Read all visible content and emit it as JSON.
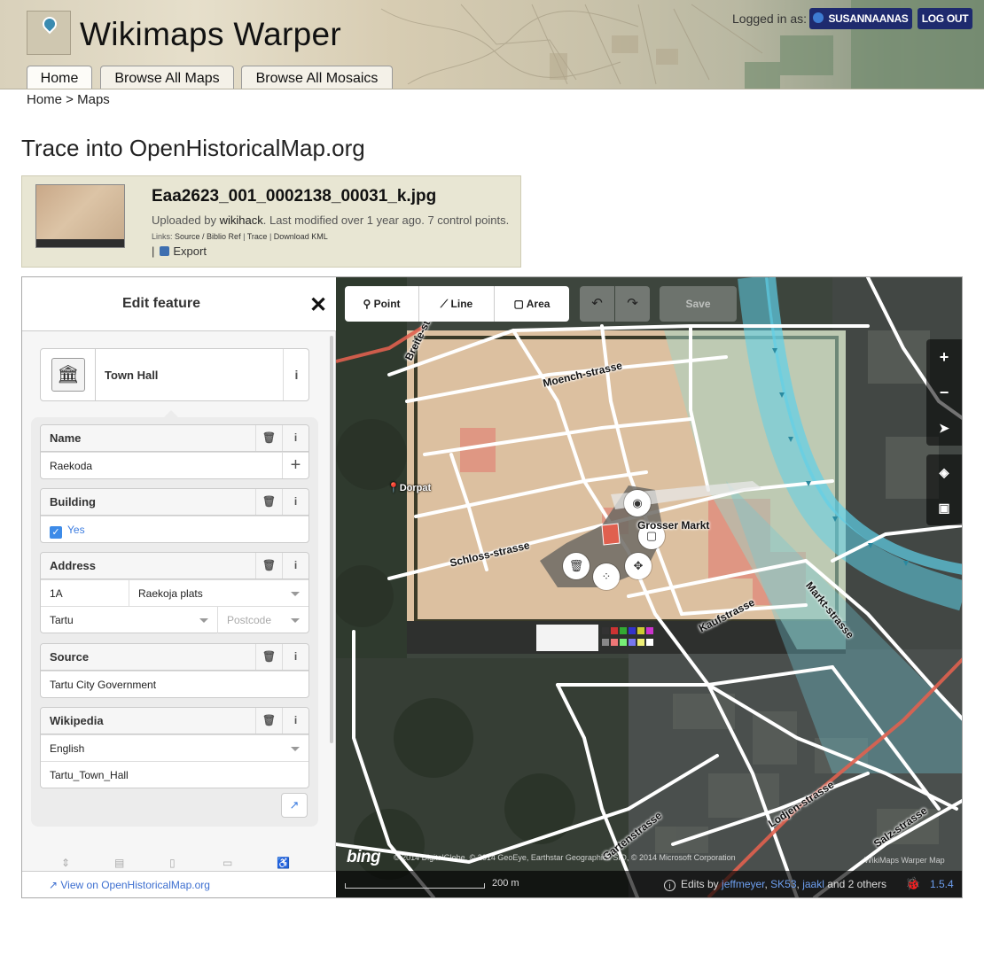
{
  "site": {
    "title": "Wikimaps Warper",
    "logged_in_label": "Logged in as:",
    "username": "SUSANNAANAS",
    "logout": "LOG OUT",
    "tabs": [
      "Home",
      "Browse All Maps",
      "Browse All Mosaics"
    ]
  },
  "breadcrumb": "Home > Maps",
  "page_title": "Trace into OpenHistoricalMap.org",
  "map_info": {
    "file_name": "Eaa2623_001_0002138_00031_k.jpg",
    "uploaded_prefix": "Uploaded by",
    "uploader": "wikihack",
    "uploaded_suffix": ". Last modified over 1 year ago. 7 control points.",
    "links_label": "Links:",
    "link_source": "Source / Biblio Ref",
    "link_trace": "Trace",
    "link_kml": "Download KML",
    "export": "Export"
  },
  "editor": {
    "sidebar_title": "Edit feature",
    "close_glyph": "✕",
    "preset_name": "Town Hall",
    "info_glyph": "i",
    "fields": {
      "name": {
        "label": "Name",
        "value": "Raekoda"
      },
      "building": {
        "label": "Building",
        "value": "Yes"
      },
      "address": {
        "label": "Address",
        "housenumber": "1A",
        "street": "Raekoja plats",
        "city": "Tartu",
        "postcode_placeholder": "Postcode"
      },
      "source": {
        "label": "Source",
        "value": "Tartu City Government"
      },
      "wikipedia": {
        "label": "Wikipedia",
        "language": "English",
        "article": "Tartu_Town_Hall"
      }
    },
    "view_on_osm": "View on OpenHistoricalMap.org"
  },
  "map": {
    "modes": {
      "point": "Point",
      "line": "Line",
      "area": "Area"
    },
    "save": "Save",
    "labels": {
      "dorpat": "Dorpat",
      "moench": "Moench-strasse",
      "schloss": "Schloss-strasse",
      "markt": "Markt-strasse",
      "kauf": "Kaufstrasse",
      "lodjen": "Lodjen-strasse",
      "garten": "Gartenstrasse",
      "salz": "Salz-strasse",
      "breite": "Breite-str",
      "gross_markt": "Grosser Markt"
    },
    "bing": "bing",
    "attribution": "© 2014 DigitalGlobe, © 2014 GeoEye, Earthstar Geographics SIO, © 2014 Microsoft Corporation",
    "watermark": "WikiMaps Warper Map",
    "scale": "200 m",
    "edits_prefix": "Edits by",
    "edit_users": [
      "jeffmeyer",
      "SK53",
      "jaakl"
    ],
    "edits_suffix": "and 2 others",
    "version": "1.5.4"
  },
  "colors": {
    "nav_button": "#1e2a6e",
    "info_box": "#e8e6d3",
    "link_blue": "#3d6fd0",
    "river_overlay": "#5fd0e8"
  }
}
